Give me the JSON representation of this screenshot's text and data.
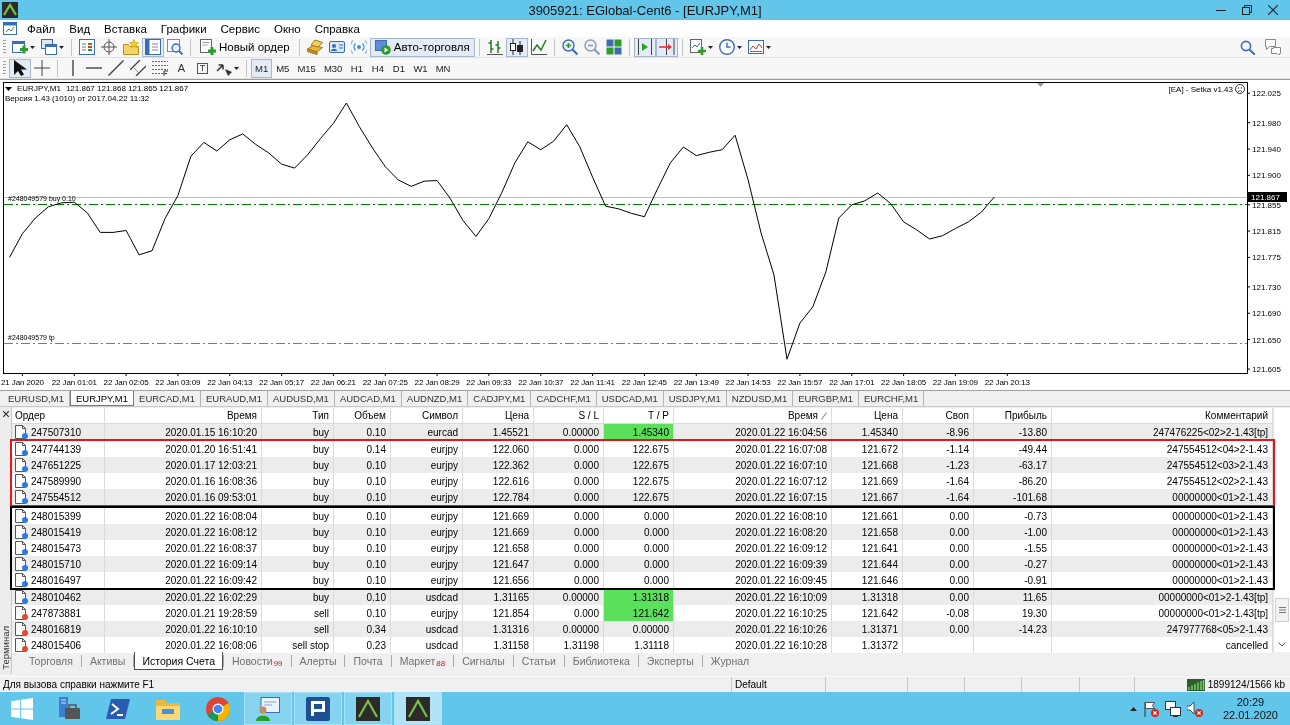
{
  "window": {
    "title": "3905921: EGlobal-Cent6 - [EURJPY,M1]"
  },
  "menu": [
    "Файл",
    "Вид",
    "Вставка",
    "Графики",
    "Сервис",
    "Окно",
    "Справка"
  ],
  "toolbar_main": [
    [
      {
        "kind": "icon",
        "pressed": false,
        "dropdown": true
      },
      {
        "kind": "icon",
        "pressed": false,
        "dropdown": true
      }
    ],
    [
      {
        "kind": "icon",
        "pressed": false,
        "dropdown": false
      },
      {
        "kind": "icon",
        "pressed": false,
        "dropdown": false
      },
      {
        "kind": "icon",
        "pressed": false,
        "dropdown": false
      },
      {
        "kind": "icon",
        "pressed": true,
        "dropdown": false
      },
      {
        "kind": "icon",
        "pressed": false,
        "dropdown": false
      }
    ],
    [
      {
        "kind": "button",
        "label": "Новый ордер",
        "pressed": false
      }
    ],
    [
      {
        "kind": "icon",
        "pressed": false,
        "dropdown": false
      },
      {
        "kind": "icon",
        "pressed": false,
        "dropdown": false
      },
      {
        "kind": "icon",
        "pressed": false,
        "dropdown": false
      },
      {
        "kind": "button",
        "label": "Авто-торговля",
        "pressed": true
      }
    ],
    [
      {
        "kind": "icon",
        "pressed": false,
        "dropdown": false
      },
      {
        "kind": "icon",
        "pressed": true,
        "dropdown": false
      },
      {
        "kind": "icon",
        "pressed": false,
        "dropdown": false
      }
    ],
    [
      {
        "kind": "icon",
        "pressed": false,
        "dropdown": false
      },
      {
        "kind": "icon",
        "pressed": false,
        "dropdown": false
      },
      {
        "kind": "icon",
        "pressed": false,
        "dropdown": false
      }
    ],
    [
      {
        "kind": "icon",
        "pressed": true,
        "dropdown": false
      },
      {
        "kind": "icon",
        "pressed": true,
        "dropdown": false
      }
    ],
    [
      {
        "kind": "icon",
        "pressed": false,
        "dropdown": true
      },
      {
        "kind": "icon",
        "pressed": false,
        "dropdown": true
      },
      {
        "kind": "icon",
        "pressed": false,
        "dropdown": true
      }
    ]
  ],
  "toolbar_tools": [
    [
      {
        "kind": "icon",
        "pressed": true,
        "dropdown": false
      },
      {
        "kind": "icon",
        "pressed": false,
        "dropdown": false
      }
    ],
    [
      {
        "kind": "icon",
        "pressed": false,
        "dropdown": false
      },
      {
        "kind": "icon",
        "pressed": false,
        "dropdown": false
      },
      {
        "kind": "icon",
        "pressed": false,
        "dropdown": false
      },
      {
        "kind": "icon",
        "pressed": false,
        "dropdown": false
      },
      {
        "kind": "icon",
        "pressed": false,
        "dropdown": false
      },
      {
        "kind": "glyph",
        "glyph": "A",
        "pressed": false
      },
      {
        "kind": "boxed_glyph",
        "glyph": "T",
        "pressed": false
      },
      {
        "kind": "icon",
        "pressed": false,
        "dropdown": true
      }
    ],
    [
      {
        "kind": "timeframe",
        "label": "M1",
        "selected": true
      },
      {
        "kind": "timeframe",
        "label": "M5",
        "selected": false
      },
      {
        "kind": "timeframe",
        "label": "M15",
        "selected": false
      },
      {
        "kind": "timeframe",
        "label": "M30",
        "selected": false
      },
      {
        "kind": "timeframe",
        "label": "H1",
        "selected": false
      },
      {
        "kind": "timeframe",
        "label": "H4",
        "selected": false
      },
      {
        "kind": "timeframe",
        "label": "D1",
        "selected": false
      },
      {
        "kind": "timeframe",
        "label": "W1",
        "selected": false
      },
      {
        "kind": "timeframe",
        "label": "MN",
        "selected": false
      }
    ]
  ],
  "chart": {
    "symbol": "EURJPY,M1",
    "prices": "121.867 121.868 121.865 121.867",
    "version": "Версия 1.43 (1010) от 2017.04.22 11:32",
    "expert": "[EA] - Setka v1.43",
    "price_tag": "121.867",
    "chart_data": {
      "type": "line",
      "color": "#000000",
      "categories": [
        null,
        "21 Jan 2020",
        null,
        null,
        null,
        "22 Jan 01:01",
        null,
        null,
        null,
        "22 Jan 02:05",
        null,
        null,
        null,
        "22 Jan 03:09",
        null,
        null,
        null,
        "22 Jan 04:13",
        null,
        null,
        null,
        "22 Jan 05:17",
        null,
        null,
        null,
        "22 Jan 06:21",
        null,
        null,
        null,
        "22 Jan 07:25",
        null,
        null,
        null,
        "22 Jan 08:29",
        null,
        null,
        null,
        "22 Jan 09:33",
        null,
        null,
        null,
        "22 Jan 10:37",
        null,
        null,
        null,
        "22 Jan 11:41",
        null,
        null,
        null,
        "22 Jan 12:45",
        null,
        null,
        null,
        "22 Jan 13:49",
        null,
        null,
        null,
        "22 Jan 14:53",
        null,
        null,
        null,
        "22 Jan 15:57",
        null,
        null,
        null,
        "22 Jan 17:01",
        null,
        null,
        null,
        "22 Jan 18:05",
        null,
        null,
        null,
        "22 Jan 19:09",
        null,
        null,
        null,
        "22 Jan 20:13",
        null,
        null,
        null,
        null,
        null,
        null,
        null,
        null,
        null,
        null,
        null,
        null,
        null,
        null,
        null,
        null,
        null,
        null
      ],
      "values": [
        121.775,
        121.811,
        121.835,
        121.852,
        121.858,
        121.859,
        121.843,
        121.813,
        121.813,
        121.816,
        121.779,
        121.785,
        121.834,
        121.869,
        121.929,
        121.95,
        121.937,
        121.954,
        121.963,
        121.947,
        121.934,
        121.917,
        121.911,
        121.931,
        121.956,
        121.979,
        122.01,
        121.974,
        121.942,
        121.913,
        121.893,
        121.883,
        121.891,
        121.892,
        121.865,
        121.831,
        121.807,
        121.834,
        121.874,
        121.919,
        121.951,
        121.939,
        121.952,
        121.977,
        121.944,
        121.897,
        121.853,
        121.849,
        121.842,
        121.837,
        121.879,
        121.919,
        121.943,
        121.93,
        121.935,
        121.939,
        121.961,
        121.893,
        121.812,
        121.748,
        121.62,
        121.675,
        121.7,
        121.753,
        121.835,
        121.855,
        121.861,
        121.873,
        121.857,
        121.829,
        121.817,
        121.803,
        121.808,
        121.819,
        121.829,
        121.844,
        121.867,
        null,
        null,
        null,
        null,
        null,
        null,
        null,
        null,
        null,
        null,
        null,
        null,
        null,
        null,
        null,
        null,
        null,
        null,
        null
      ],
      "ylim": [
        121.599,
        122.042
      ],
      "yticks": [
        122.025,
        {
          "value": 121.98,
          "label": "121.980"
        },
        {
          "value": 121.94,
          "label": "121.940"
        },
        {
          "value": 121.9,
          "label": "121.900"
        },
        121.855,
        121.815,
        121.775,
        {
          "value": 121.73,
          "label": "121.730"
        },
        {
          "value": 121.69,
          "label": "121.690"
        },
        {
          "value": 121.65,
          "label": "121.650"
        },
        121.605
      ],
      "ref_lines": [
        {
          "axis": "y",
          "value": 121.867,
          "color": "#c0c0c0",
          "line_style": "solid"
        },
        {
          "axis": "y",
          "value": 121.856,
          "label": "#248049579 buy 0.10",
          "color": "#008000",
          "line_style": "dashdot"
        },
        {
          "axis": "y",
          "value": 121.644,
          "label": "#248049579 tp",
          "color": "#ff4a1c",
          "line_style": "dashdot"
        }
      ]
    }
  },
  "chart_tabs": [
    {
      "label": "EURUSD,M1",
      "selected": false
    },
    {
      "label": "EURJPY,M1",
      "selected": true
    },
    {
      "label": "EURCAD,M1",
      "selected": false
    },
    {
      "label": "EURAUD,M1",
      "selected": false
    },
    {
      "label": "AUDUSD,M1",
      "selected": false
    },
    {
      "label": "AUDCAD,M1",
      "selected": false
    },
    {
      "label": "AUDNZD,M1",
      "selected": false
    },
    {
      "label": "CADJPY,M1",
      "selected": false
    },
    {
      "label": "CADCHF,M1",
      "selected": false
    },
    {
      "label": "USDCAD,M1",
      "selected": false
    },
    {
      "label": "USDJPY,M1",
      "selected": false
    },
    {
      "label": "NZDUSD,M1",
      "selected": false
    },
    {
      "label": "EURGBP,M1",
      "selected": false
    },
    {
      "label": "EURCHF,M1",
      "selected": false
    }
  ],
  "terminal": {
    "title": "Терминал",
    "columns": [
      {
        "label": "Ордер",
        "sorted": false
      },
      {
        "label": "Время",
        "sorted": false
      },
      {
        "label": "Тип",
        "sorted": false
      },
      {
        "label": "Объем",
        "sorted": false
      },
      {
        "label": "Символ",
        "sorted": false
      },
      {
        "label": "Цена",
        "sorted": false
      },
      {
        "label": "S / L",
        "sorted": false
      },
      {
        "label": "T / P",
        "sorted": false
      },
      {
        "label": "Время",
        "sorted": true
      },
      {
        "label": "Цена",
        "sorted": false
      },
      {
        "label": "Своп",
        "sorted": false
      },
      {
        "label": "Прибыль",
        "sorted": false
      },
      {
        "label": "Комментарий",
        "sorted": false
      }
    ],
    "rows": [
      {
        "kind": "buy",
        "tp_hit": true,
        "cells": [
          "247507310",
          "2020.01.15 16:10:20",
          "buy",
          "0.10",
          "eurcad",
          "1.45521",
          "0.00000",
          "1.45340",
          "2020.01.22 16:04:56",
          "1.45340",
          "-8.96",
          "-13.80",
          "247476225<02>2-1.43[tp]"
        ]
      },
      {
        "kind": "buy",
        "tp_hit": false,
        "color": "#e8141c",
        "cells": [
          "247744139",
          "2020.01.20 16:51:41",
          "buy",
          "0.14",
          "eurjpy",
          "122.060",
          "0.000",
          "122.675",
          "2020.01.22 16:07:08",
          "121.672",
          "-1.14",
          "-49.44",
          "247554512<04>2-1.43"
        ]
      },
      {
        "kind": "buy",
        "tp_hit": false,
        "color": "#e8141c",
        "cells": [
          "247651225",
          "2020.01.17 12:03:21",
          "buy",
          "0.10",
          "eurjpy",
          "122.362",
          "0.000",
          "122.675",
          "2020.01.22 16:07:10",
          "121.668",
          "-1.23",
          "-63.17",
          "247554512<03>2-1.43"
        ]
      },
      {
        "kind": "buy",
        "tp_hit": false,
        "color": "#e8141c",
        "cells": [
          "247589990",
          "2020.01.16 16:08:36",
          "buy",
          "0.10",
          "eurjpy",
          "122.616",
          "0.000",
          "122.675",
          "2020.01.22 16:07:12",
          "121.669",
          "-1.64",
          "-86.20",
          "247554512<02>2-1.43"
        ]
      },
      {
        "kind": "buy",
        "tp_hit": false,
        "color": "#e8141c",
        "cells": [
          "247554512",
          "2020.01.16 09:53:01",
          "buy",
          "0.10",
          "eurjpy",
          "122.784",
          "0.000",
          "122.675",
          "2020.01.22 16:07:15",
          "121.667",
          "-1.64",
          "-101.68",
          "00000000<01>2-1.43"
        ]
      },
      {
        "kind": "buy",
        "tp_hit": false,
        "color": "#000000",
        "cells": [
          "248015399",
          "2020.01.22 16:08:04",
          "buy",
          "0.10",
          "eurjpy",
          "121.669",
          "0.000",
          "0.000",
          "2020.01.22 16:08:10",
          "121.661",
          "0.00",
          "-0.73",
          "00000000<01>2-1.43"
        ]
      },
      {
        "kind": "buy",
        "tp_hit": false,
        "color": "#000000",
        "cells": [
          "248015419",
          "2020.01.22 16:08:12",
          "buy",
          "0.10",
          "eurjpy",
          "121.669",
          "0.000",
          "0.000",
          "2020.01.22 16:08:20",
          "121.658",
          "0.00",
          "-1.00",
          "00000000<01>2-1.43"
        ]
      },
      {
        "kind": "buy",
        "tp_hit": false,
        "color": "#000000",
        "cells": [
          "248015473",
          "2020.01.22 16:08:37",
          "buy",
          "0.10",
          "eurjpy",
          "121.658",
          "0.000",
          "0.000",
          "2020.01.22 16:09:12",
          "121.641",
          "0.00",
          "-1.55",
          "00000000<01>2-1.43"
        ]
      },
      {
        "kind": "buy",
        "tp_hit": false,
        "color": "#000000",
        "cells": [
          "248015710",
          "2020.01.22 16:09:14",
          "buy",
          "0.10",
          "eurjpy",
          "121.647",
          "0.000",
          "0.000",
          "2020.01.22 16:09:39",
          "121.644",
          "0.00",
          "-0.27",
          "00000000<01>2-1.43"
        ]
      },
      {
        "kind": "buy",
        "tp_hit": false,
        "color": "#000000",
        "cells": [
          "248016497",
          "2020.01.22 16:09:42",
          "buy",
          "0.10",
          "eurjpy",
          "121.656",
          "0.000",
          "0.000",
          "2020.01.22 16:09:45",
          "121.646",
          "0.00",
          "-0.91",
          "00000000<01>2-1.43"
        ]
      },
      {
        "kind": "buy",
        "tp_hit": true,
        "cells": [
          "248010462",
          "2020.01.22 16:02:29",
          "buy",
          "0.10",
          "usdcad",
          "1.31165",
          "0.00000",
          "1.31318",
          "2020.01.22 16:10:09",
          "1.31318",
          "0.00",
          "11.65",
          "00000000<01>2-1.43[tp]"
        ]
      },
      {
        "kind": "sell",
        "tp_hit": true,
        "cells": [
          "247873881",
          "2020.01.21 19:28:59",
          "sell",
          "0.10",
          "eurjpy",
          "121.854",
          "0.000",
          "121.642",
          "2020.01.22 16:10:25",
          "121.642",
          "-0.08",
          "19.30",
          "00000000<01>2-1.43[tp]"
        ]
      },
      {
        "kind": "sell",
        "tp_hit": false,
        "cells": [
          "248016819",
          "2020.01.22 16:10:10",
          "sell",
          "0.34",
          "usdcad",
          "1.31316",
          "0.00000",
          "0.00000",
          "2020.01.22 16:10:26",
          "1.31371",
          "0.00",
          "-14.23",
          "247977768<05>2-1.43"
        ]
      },
      {
        "kind": "sell",
        "tp_hit": false,
        "cells": [
          "248015406",
          "2020.01.22 16:08:06",
          "sell stop",
          "0.23",
          "usdcad",
          "1.31158",
          "1.31198",
          "1.31118",
          "2020.01.22 16:10:28",
          "1.31372",
          null,
          null,
          "cancelled"
        ]
      }
    ],
    "tabs": [
      {
        "label": "Торговля",
        "selected": false
      },
      {
        "label": "Активы",
        "selected": false
      },
      {
        "label": "История Счета",
        "selected": true
      },
      {
        "label": "Новости",
        "badge": "99",
        "selected": false
      },
      {
        "label": "Алерты",
        "selected": false
      },
      {
        "label": "Почта",
        "selected": false
      },
      {
        "label": "Маркет",
        "badge": "88",
        "selected": false
      },
      {
        "label": "Сигналы",
        "selected": false
      },
      {
        "label": "Статьи",
        "selected": false
      },
      {
        "label": "Библиотека",
        "selected": false
      },
      {
        "label": "Эксперты",
        "selected": false
      },
      {
        "label": "Журнал",
        "selected": false
      }
    ]
  },
  "status_bar": {
    "help": "Для вызова справки нажмите F1",
    "profile": "Default",
    "traffic": "1899124/1566 kb"
  },
  "taskbar": {
    "apps": [
      {
        "running": false,
        "active": false
      },
      {
        "running": false,
        "active": false
      },
      {
        "running": false,
        "active": false
      },
      {
        "running": false,
        "active": false
      },
      {
        "running": true,
        "active": false
      },
      {
        "running": true,
        "active": false
      },
      {
        "running": true,
        "active": false
      },
      {
        "running": true,
        "active": true
      }
    ],
    "time": "20:29",
    "date": "22.01.2020"
  }
}
